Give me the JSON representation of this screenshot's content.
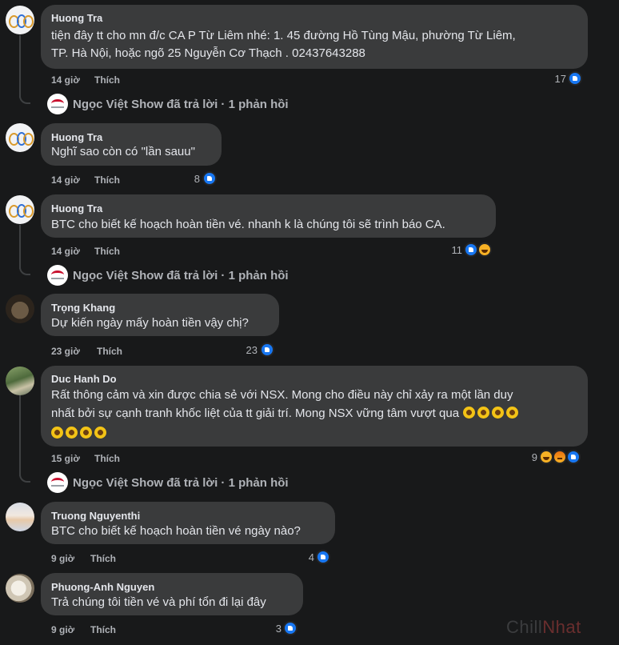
{
  "comments": [
    {
      "author": "Huong Tra",
      "lines": [
        "tiện đây tt cho mn đ/c CA P Từ Liêm nhé: 1. 45 đường Hồ Tùng Mậu, phường Từ Liêm,",
        "TP. Hà Nội, hoặc ngõ 25 Nguyễn Cơ Thạch . 02437643288"
      ],
      "time": "14 giờ",
      "like_label": "Thích",
      "reaction_count": "17",
      "reactions": [
        "like"
      ]
    },
    {
      "author": "Huong Tra",
      "lines": [
        "Nghĩ sao còn có \"lần sauu\""
      ],
      "time": "14 giờ",
      "like_label": "Thích",
      "reaction_count": "8",
      "reactions": [
        "like"
      ]
    },
    {
      "author": "Huong Tra",
      "lines": [
        "BTC cho biết kế hoạch hoàn tiền vé. nhanh k là chúng tôi sẽ trình báo CA."
      ],
      "time": "14 giờ",
      "like_label": "Thích",
      "reaction_count": "11",
      "reactions": [
        "like",
        "haha"
      ]
    },
    {
      "author": "Trọng Khang",
      "lines": [
        "Dự kiến ngày mấy hoàn tiền vậy chị?"
      ],
      "time": "23 giờ",
      "like_label": "Thích",
      "reaction_count": "23",
      "reactions": [
        "like"
      ]
    },
    {
      "author": "Duc Hanh Do",
      "lines": [
        "Rất thông cảm và xin được chia sẻ với NSX. Mong cho điều này chỉ xảy ra một lần duy",
        "nhất bởi sự cạnh tranh khốc liệt của tt giải trí. Mong NSX vững tâm vượt qua",
        ""
      ],
      "emoji_icon": "sunflower-emoji",
      "time": "15 giờ",
      "like_label": "Thích",
      "reaction_count": "9",
      "reactions": [
        "haha",
        "angry",
        "like"
      ]
    },
    {
      "author": "Truong Nguyenthi",
      "lines": [
        "BTC cho biết kế hoạch hoàn tiền vé ngày nào?"
      ],
      "time": "9 giờ",
      "like_label": "Thích",
      "reaction_count": "4",
      "reactions": [
        "like"
      ]
    },
    {
      "author": "Phuong-Anh Nguyen",
      "lines": [
        "Trả chúng tôi tiền vé và phí tổn đi lại đây"
      ],
      "time": "9 giờ",
      "like_label": "Thích",
      "reaction_count": "3",
      "reactions": [
        "like"
      ]
    }
  ],
  "replies": [
    {
      "author": "Ngọc Việt Show",
      "text": "Ngọc Việt Show đã trả lời · 1 phản hồi"
    },
    {
      "author": "Ngọc Việt Show",
      "text": "Ngọc Việt Show đã trả lời · 1 phản hồi"
    },
    {
      "author": "Ngọc Việt Show",
      "text": "Ngọc Việt Show đã trả lời · 1 phản hồi"
    }
  ],
  "watermark": {
    "part1": "Chill",
    "part2": "Nhat"
  },
  "colors": {
    "background": "#18191a",
    "bubble": "#3a3b3c",
    "like": "#1877f2",
    "haha": "#f7b125",
    "meta": "#b0b3b8"
  }
}
